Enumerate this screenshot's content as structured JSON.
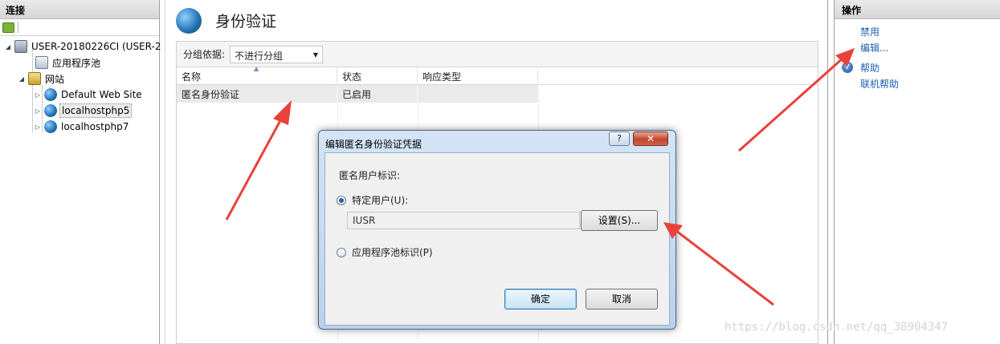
{
  "connections": {
    "title": "连接",
    "tree": {
      "server": "USER-20180226CI (USER-2",
      "app_pools": "应用程序池",
      "sites": "网站",
      "site_items": [
        "Default Web Site",
        "localhostphp5",
        "localhostphp7"
      ]
    }
  },
  "main": {
    "title": "身份验证",
    "group_label": "分组依据:",
    "group_value": "不进行分组",
    "columns": [
      "名称",
      "状态",
      "响应类型"
    ],
    "rows": [
      {
        "name": "匿名身份验证",
        "status": "已启用",
        "type": ""
      }
    ]
  },
  "actions": {
    "title": "操作",
    "disable": "禁用",
    "edit": "编辑...",
    "help": "帮助",
    "online_help": "联机帮助"
  },
  "dialog": {
    "title": "编辑匿名身份验证凭据",
    "help_glyph": "?",
    "close_glyph": "✕",
    "section_label": "匿名用户标识:",
    "option_specific": "特定用户(U):",
    "user_value": "IUSR",
    "set_button": "设置(S)...",
    "option_pool": "应用程序池标识(P)",
    "ok": "确定",
    "cancel": "取消"
  },
  "annotations": {
    "arrow_color": "#e8423a"
  },
  "watermark": "https://blog.csdn.net/qq_38904347"
}
